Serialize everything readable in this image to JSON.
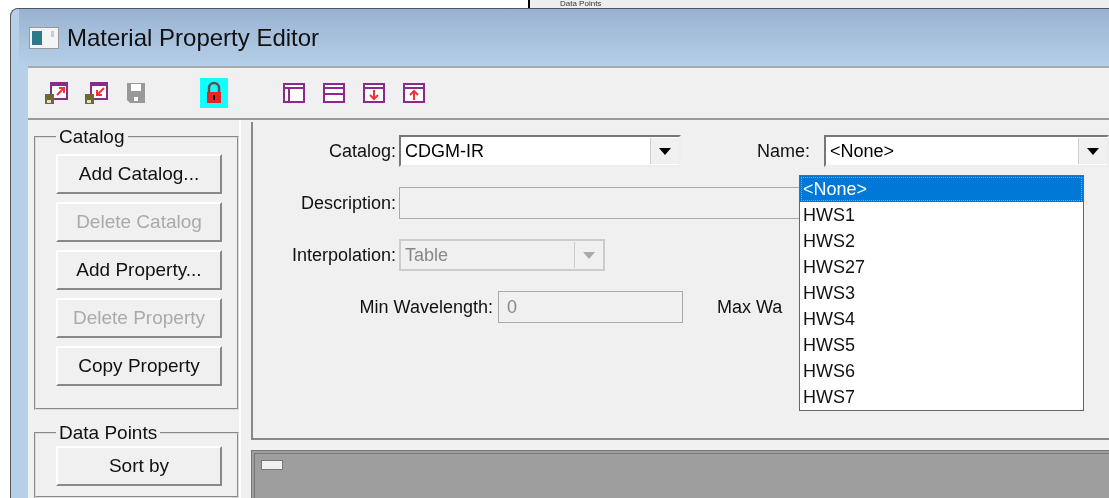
{
  "background_window": {
    "group_title": "Data Points"
  },
  "window": {
    "title": "Material Property Editor"
  },
  "toolbar": [
    {
      "kind": "export",
      "disabled": false,
      "on": false
    },
    {
      "kind": "import",
      "disabled": false,
      "on": false
    },
    {
      "kind": "save",
      "disabled": true,
      "on": false
    },
    {
      "kind": "lock",
      "disabled": false,
      "on": true
    },
    {
      "kind": "layout-left",
      "disabled": false,
      "on": false
    },
    {
      "kind": "layout-rows",
      "disabled": false,
      "on": false
    },
    {
      "kind": "move-down",
      "disabled": false,
      "on": false
    },
    {
      "kind": "move-up",
      "disabled": false,
      "on": false
    }
  ],
  "catalog_group": {
    "title": "Catalog",
    "buttons": [
      {
        "label": "Add Catalog...",
        "disabled": false
      },
      {
        "label": "Delete Catalog",
        "disabled": true
      },
      {
        "label": "Add  Property...",
        "disabled": false
      },
      {
        "label": "Delete Property",
        "disabled": true
      },
      {
        "label": "Copy Property",
        "disabled": false
      }
    ]
  },
  "data_points_group": {
    "title": "Data Points",
    "buttons": [
      {
        "label": "Sort by",
        "disabled": false
      }
    ]
  },
  "form": {
    "catalog": {
      "label": "Catalog:",
      "value": "CDGM-IR",
      "disabled": false
    },
    "name": {
      "label": "Name:",
      "value": "<None>",
      "expanded": true,
      "options": [
        {
          "label": "<None>",
          "selected": true
        },
        {
          "label": "HWS1",
          "selected": false
        },
        {
          "label": "HWS2",
          "selected": false
        },
        {
          "label": "HWS27",
          "selected": false
        },
        {
          "label": "HWS3",
          "selected": false
        },
        {
          "label": "HWS4",
          "selected": false
        },
        {
          "label": "HWS5",
          "selected": false
        },
        {
          "label": "HWS6",
          "selected": false
        },
        {
          "label": "HWS7",
          "selected": false
        }
      ]
    },
    "description": {
      "label": "Description:",
      "disabled": true
    },
    "interpolation": {
      "label": "Interpolation:",
      "value": "Table",
      "disabled": true
    },
    "min_wavelength": {
      "label": "Min Wavelength:",
      "value": "0",
      "disabled": true
    },
    "max_wavelength": {
      "label": "Max Wa"
    }
  }
}
